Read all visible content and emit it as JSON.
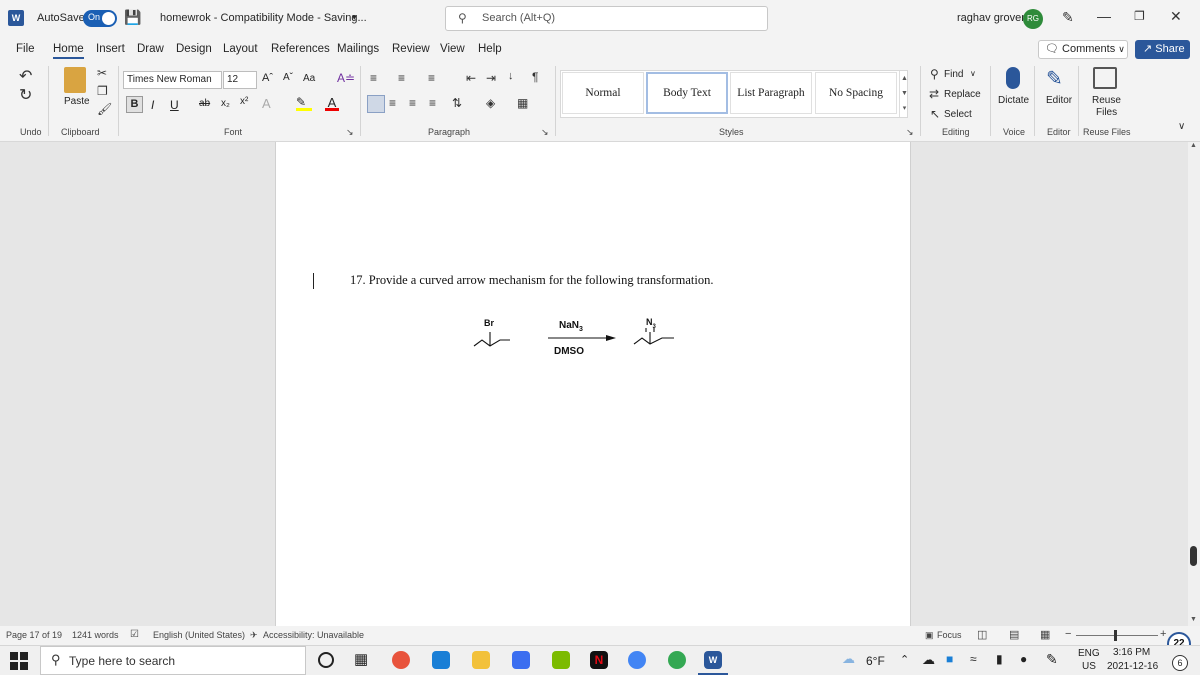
{
  "titlebar": {
    "app_logo": "W",
    "autosave_label": "AutoSave",
    "autosave_state": "On",
    "doc_title": "homewrok - Compatibility Mode - Saving...",
    "search_placeholder": "Search (Alt+Q)",
    "user_name": "raghav grover",
    "user_initials": "RG"
  },
  "menu": {
    "tabs": [
      "File",
      "Home",
      "Insert",
      "Draw",
      "Design",
      "Layout",
      "References",
      "Mailings",
      "Review",
      "View",
      "Help"
    ],
    "active_tab": "Home",
    "comments_label": "Comments",
    "share_label": "Share"
  },
  "ribbon": {
    "undo_label": "Undo",
    "paste_label": "Paste",
    "clipboard_label": "Clipboard",
    "font_name": "Times New Roman",
    "font_size": "12",
    "font_label": "Font",
    "paragraph_label": "Paragraph",
    "styles": [
      "Normal",
      "Body Text",
      "List Paragraph",
      "No Spacing"
    ],
    "selected_style": "Body Text",
    "styles_label": "Styles",
    "find_label": "Find",
    "replace_label": "Replace",
    "select_label": "Select",
    "editing_label": "Editing",
    "dictate_label": "Dictate",
    "voice_label": "Voice",
    "editor_label": "Editor",
    "editor_group_label": "Editor",
    "reuse_label": "Reuse",
    "files_label": "Files",
    "reuse_files_label": "Reuse Files",
    "case_label": "Aa"
  },
  "document": {
    "question": "17. Provide a curved arrow mechanism for the following transformation.",
    "reactant_label": "Br",
    "reagent_top_main": "NaN",
    "reagent_top_sub": "3",
    "reagent_bottom": "DMSO",
    "product_main": "N",
    "product_sub": "3"
  },
  "status": {
    "page": "Page 17 of 19",
    "words": "1241 words",
    "language": "English (United States)",
    "accessibility": "Accessibility: Unavailable",
    "focus": "Focus",
    "zoom_minus": "−",
    "zoom_plus": "+"
  },
  "taskbar": {
    "search_placeholder": "Type here to search",
    "weather": "6°F",
    "lang_top": "ENG",
    "lang_bottom": "US",
    "time": "3:16 PM",
    "date": "2021-12-16",
    "notification_count": "6",
    "badge_count": "22"
  },
  "colors": {
    "word_blue": "#2b579a",
    "avatar_green": "#2e8b3a"
  }
}
